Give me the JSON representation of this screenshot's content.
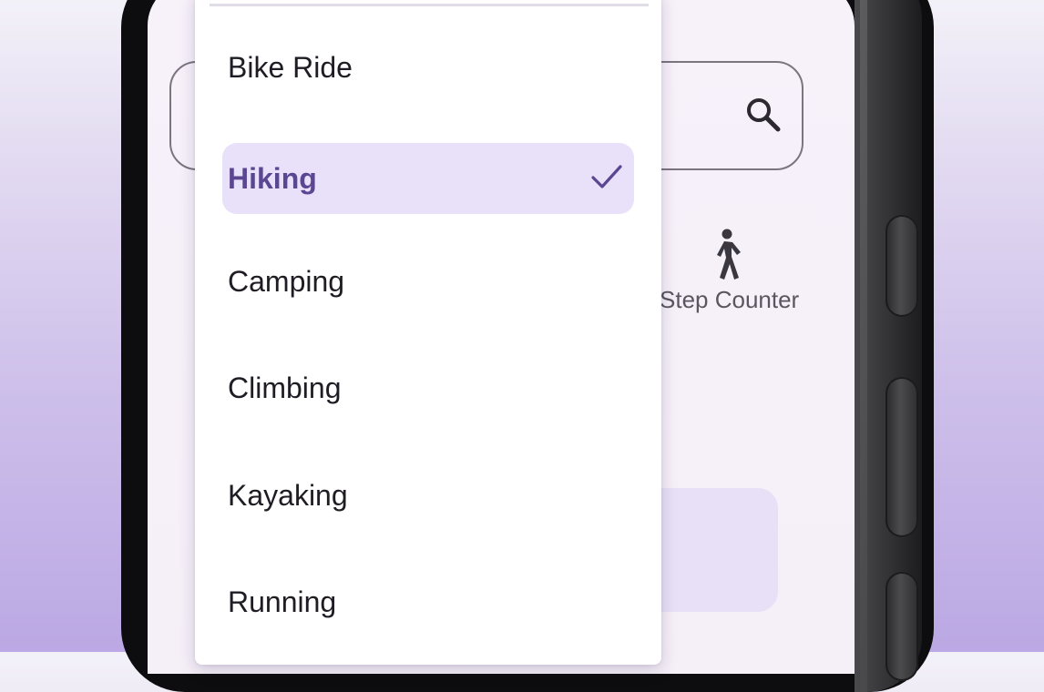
{
  "background": {
    "top_color": "#f3f1f8",
    "bottom_color": "#bba8e4"
  },
  "screen": {
    "search": {
      "icon": "search-icon"
    },
    "shortcut": {
      "icon": "walking-person-icon",
      "label": "Step Counter"
    }
  },
  "dropdown": {
    "items": [
      {
        "label": "Bike Ride",
        "selected": false
      },
      {
        "label": "Hiking",
        "selected": true
      },
      {
        "label": "Camping",
        "selected": false
      },
      {
        "label": "Climbing",
        "selected": false
      },
      {
        "label": "Kayaking",
        "selected": false
      },
      {
        "label": "Running",
        "selected": false
      }
    ],
    "selected_icon": "check-icon"
  },
  "colors": {
    "accent": "#5b4692",
    "selected_bg": "#e9e0fa",
    "menu_bg": "#ffffff",
    "screen_bg": "#f6f0f9"
  }
}
